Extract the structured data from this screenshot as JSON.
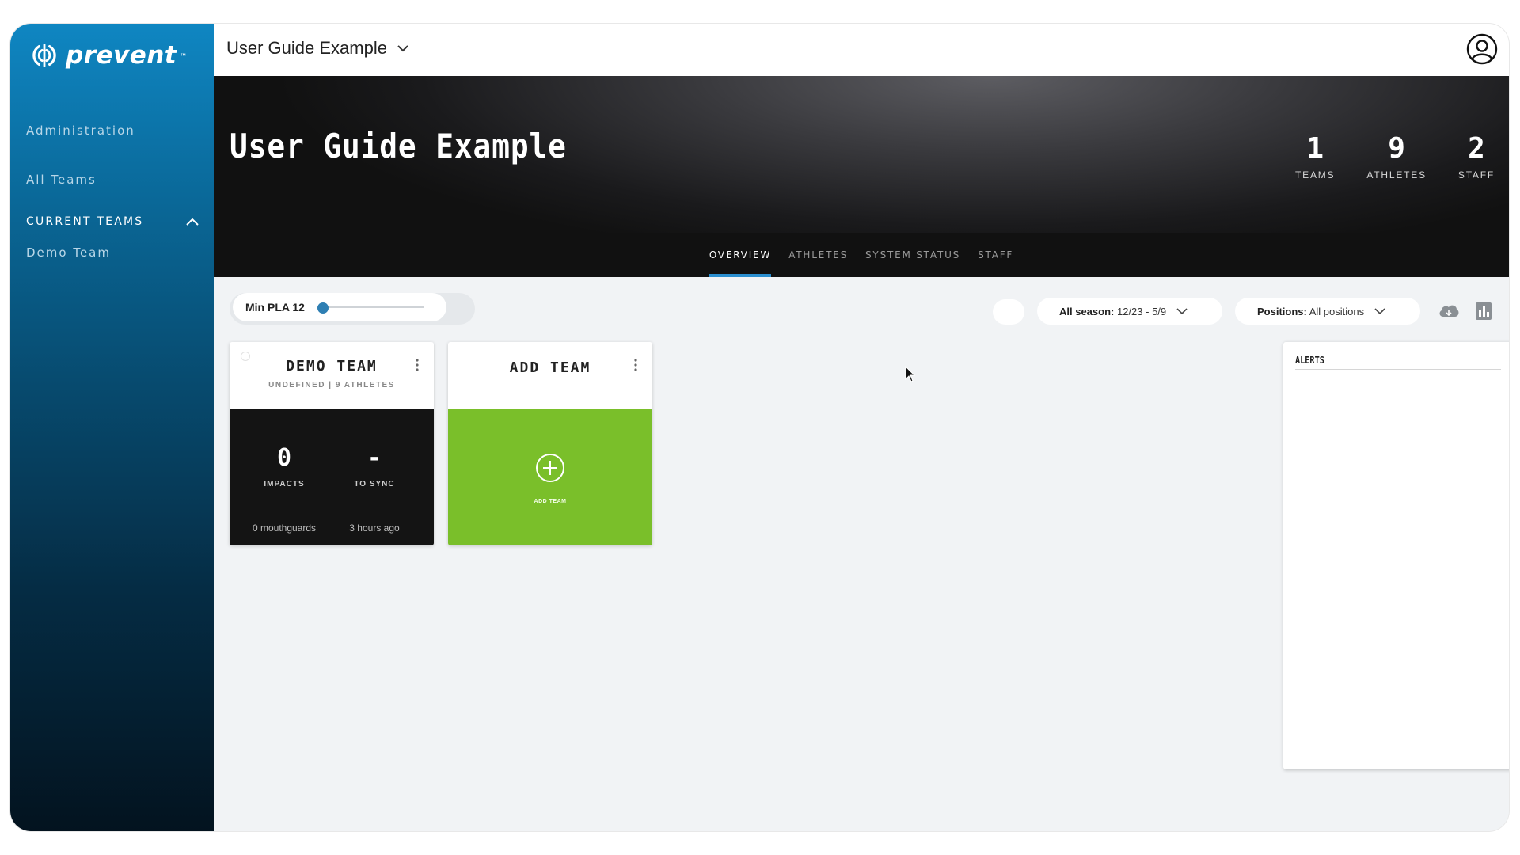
{
  "app": {
    "logo_text": "prevent",
    "logo_tm": "™"
  },
  "sidebar": {
    "items": [
      {
        "label": "Administration"
      },
      {
        "label": "All Teams"
      }
    ],
    "section": {
      "label": "CURRENT TEAMS",
      "expanded": true
    },
    "teams": [
      {
        "label": "Demo Team"
      }
    ]
  },
  "topbar": {
    "team_selector": "User Guide Example"
  },
  "hero": {
    "title": "User Guide Example",
    "stats": [
      {
        "value": "1",
        "label": "TEAMS"
      },
      {
        "value": "9",
        "label": "ATHLETES"
      },
      {
        "value": "2",
        "label": "STAFF"
      }
    ]
  },
  "tabs": [
    {
      "label": "OVERVIEW",
      "active": true
    },
    {
      "label": "ATHLETES",
      "active": false
    },
    {
      "label": "SYSTEM STATUS",
      "active": false
    },
    {
      "label": "STAFF",
      "active": false
    }
  ],
  "filters": {
    "min_pla": {
      "label": "Min PLA 12",
      "value": 12
    },
    "season": {
      "label": "All season:",
      "value": "12/23 - 5/9"
    },
    "positions": {
      "label": "Positions:",
      "value": "All positions"
    }
  },
  "cards": {
    "demo": {
      "title": "DEMO TEAM",
      "subtitle": "UNDEFINED | 9 ATHLETES",
      "impacts": {
        "value": "0",
        "label": "IMPACTS"
      },
      "to_sync": {
        "value": "-",
        "label": "TO SYNC"
      },
      "mouthguards": "0 mouthguards",
      "last_sync": "3 hours ago"
    },
    "add": {
      "title": "ADD TEAM",
      "button_label": "ADD TEAM"
    }
  },
  "alerts": {
    "title": "ALERTS"
  },
  "colors": {
    "accent": "#2b8fd0",
    "add_team_green": "#7abf2a",
    "sidebar_top": "#0f86c2",
    "sidebar_bottom": "#03131f"
  },
  "icons": {
    "logo": "prevent-logo-icon",
    "chevron": "chevron-down-icon",
    "avatar": "user-avatar-icon",
    "download": "cloud-download-icon",
    "chart": "bar-chart-icon",
    "kebab": "kebab-menu-icon",
    "add": "plus-circle-icon"
  }
}
